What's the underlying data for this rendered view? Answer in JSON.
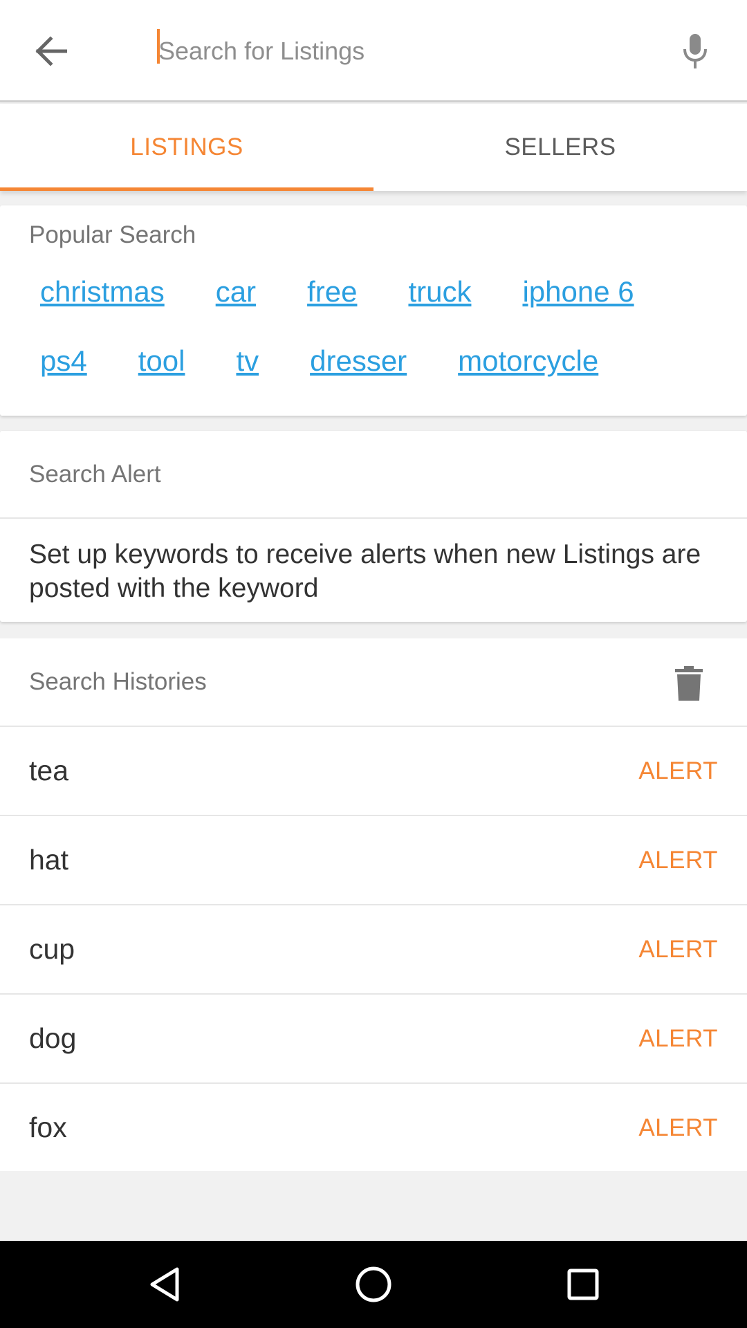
{
  "search": {
    "placeholder": "Search for Listings",
    "value": ""
  },
  "icons": {
    "back": "arrow-left-icon",
    "mic": "microphone-icon",
    "trash": "trash-icon",
    "nav_back": "triangle-back-icon",
    "nav_home": "circle-home-icon",
    "nav_recent": "square-recent-icon"
  },
  "colors": {
    "accent": "#f58634",
    "link": "#2b9fe0"
  },
  "tabs": [
    {
      "label": "LISTINGS",
      "active": true
    },
    {
      "label": "SELLERS",
      "active": false
    }
  ],
  "popular": {
    "title": "Popular Search",
    "row1": [
      "christmas",
      "car",
      "free",
      "truck",
      "iphone 6"
    ],
    "row2": [
      "ps4",
      "tool",
      "tv",
      "dresser",
      "motorcycle"
    ]
  },
  "alert": {
    "title": "Search Alert",
    "description": "Set up keywords to receive alerts when new Listings are posted with the keyword"
  },
  "history": {
    "title": "Search Histories",
    "action_label": "ALERT",
    "items": [
      "tea",
      "hat",
      "cup",
      "dog",
      "fox"
    ]
  }
}
